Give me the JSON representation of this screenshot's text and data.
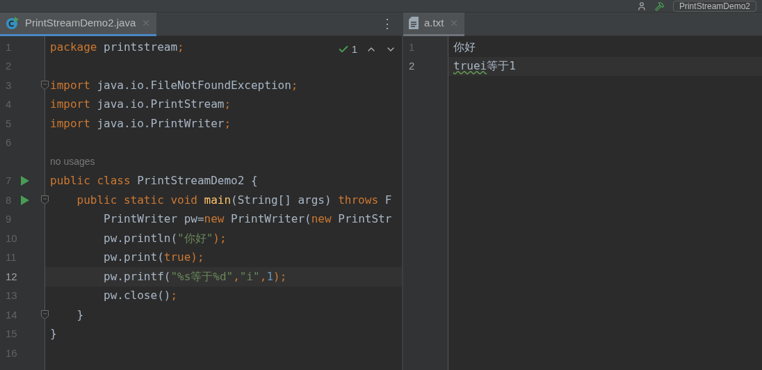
{
  "toolbar": {
    "run_config": "PrintStreamDemo2"
  },
  "panes": [
    {
      "focused": true,
      "tab": {
        "label": "PrintStreamDemo2.java",
        "kind": "java",
        "selected": true
      },
      "menu": "⋮",
      "inspection": {
        "count": "1"
      },
      "lines": [
        {
          "number": "1",
          "current": false,
          "tokens": [
            {
              "text": "package",
              "kind": "kw"
            },
            {
              "text": " printstream",
              "kind": "plain"
            },
            {
              "text": ";",
              "kind": "kw"
            }
          ]
        },
        {
          "number": "2",
          "current": false
        },
        {
          "number": "3",
          "current": false,
          "fold": true,
          "tokens": [
            {
              "text": "import",
              "kind": "kw"
            },
            {
              "text": " java.io.FileNotFoundException",
              "kind": "plain"
            },
            {
              "text": ";",
              "kind": "kw"
            }
          ]
        },
        {
          "number": "4",
          "current": false,
          "tokens": [
            {
              "text": "import",
              "kind": "kw"
            },
            {
              "text": " java.io.PrintStream",
              "kind": "plain"
            },
            {
              "text": ";",
              "kind": "kw"
            }
          ]
        },
        {
          "number": "5",
          "current": false,
          "tokens": [
            {
              "text": "import",
              "kind": "kw"
            },
            {
              "text": " java.io.PrintWriter",
              "kind": "plain"
            },
            {
              "text": ";",
              "kind": "kw"
            }
          ]
        },
        {
          "number": "6",
          "current": false
        },
        {
          "number": "7",
          "current": false,
          "run": true,
          "hint": "no usages",
          "tokens": [
            {
              "text": "public class",
              "kind": "kw"
            },
            {
              "text": " PrintStreamDemo2 {",
              "kind": "plain"
            }
          ]
        },
        {
          "number": "8",
          "current": false,
          "run": true,
          "fold": true,
          "tokens": [
            {
              "text": "    public static void ",
              "kind": "kw"
            },
            {
              "text": "main",
              "kind": "method"
            },
            {
              "text": "(String[] args) ",
              "kind": "plain"
            },
            {
              "text": "throws",
              "kind": "kw"
            },
            {
              "text": " F",
              "kind": "plain"
            }
          ]
        },
        {
          "number": "9",
          "current": false,
          "tokens": [
            {
              "text": "        PrintWriter pw=",
              "kind": "plain"
            },
            {
              "text": "new",
              "kind": "kw"
            },
            {
              "text": " PrintWriter(",
              "kind": "plain"
            },
            {
              "text": "new",
              "kind": "kw"
            },
            {
              "text": " PrintStr",
              "kind": "plain"
            }
          ]
        },
        {
          "number": "10",
          "current": false,
          "tokens": [
            {
              "text": "        pw.println(",
              "kind": "plain"
            },
            {
              "text": "\"你好\"",
              "kind": "str"
            },
            {
              "text": ");",
              "kind": "kw"
            }
          ]
        },
        {
          "number": "11",
          "current": false,
          "tokens": [
            {
              "text": "        pw.print(",
              "kind": "plain"
            },
            {
              "text": "true",
              "kind": "kw"
            },
            {
              "text": ");",
              "kind": "kw"
            }
          ]
        },
        {
          "number": "12",
          "current": true,
          "tokens": [
            {
              "text": "        pw.printf(",
              "kind": "plain"
            },
            {
              "text": "\"%s等于%d\"",
              "kind": "str"
            },
            {
              "text": ",",
              "kind": "kw"
            },
            {
              "text": "\"i\"",
              "kind": "str"
            },
            {
              "text": ",",
              "kind": "kw"
            },
            {
              "text": "1",
              "kind": "num"
            },
            {
              "text": ");",
              "kind": "kw"
            }
          ]
        },
        {
          "number": "13",
          "current": false,
          "tokens": [
            {
              "text": "        pw.close()",
              "kind": "plain"
            },
            {
              "text": ";",
              "kind": "kw"
            }
          ]
        },
        {
          "number": "14",
          "current": false,
          "fold": true,
          "tokens": [
            {
              "text": "    }",
              "kind": "plain"
            }
          ]
        },
        {
          "number": "15",
          "current": false,
          "tokens": [
            {
              "text": "}",
              "kind": "plain"
            }
          ]
        },
        {
          "number": "16",
          "current": false
        }
      ]
    },
    {
      "focused": false,
      "tab": {
        "label": "a.txt",
        "kind": "text",
        "selected": true
      },
      "lines": [
        {
          "number": "1",
          "current": false,
          "tokens": [
            {
              "text": "你好",
              "kind": "plain"
            }
          ]
        },
        {
          "number": "2",
          "current": true,
          "tokens": [
            {
              "text": "truei",
              "kind": "typo"
            },
            {
              "text": "等于1",
              "kind": "plain"
            }
          ]
        }
      ]
    }
  ]
}
